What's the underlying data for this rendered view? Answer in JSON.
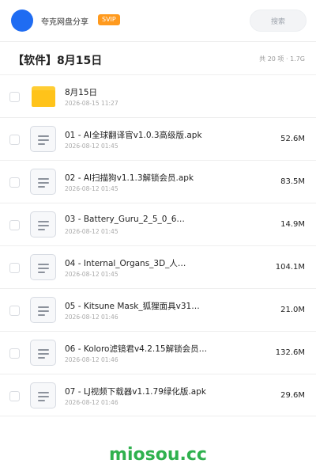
{
  "header": {
    "username": "夸克网盘分享",
    "badge": "SVIP",
    "search_placeholder": "搜索",
    "avatar_color": "#1f6cf2",
    "badge_color": "#ff9a1e"
  },
  "folder": {
    "title": "【软件】8月15日",
    "summary": "共 20 项 · 1.7G"
  },
  "items": [
    {
      "type": "folder",
      "name": "8月15日",
      "date": "2026-08-15 11:27",
      "size": ""
    },
    {
      "type": "file",
      "name": "01 - AI全球翻译官v1.0.3高级版.apk",
      "date": "2026-08-12 01:45",
      "size": "52.6M"
    },
    {
      "type": "file",
      "name": "02 - AI扫描狗v1.1.3解锁会员.apk",
      "date": "2026-08-12 01:45",
      "size": "83.5M"
    },
    {
      "type": "file",
      "name": "03 - Battery_Guru_2_5_0_6…",
      "date": "2026-08-12 01:45",
      "size": "14.9M"
    },
    {
      "type": "file",
      "name": "04 - Internal_Organs_3D_人…",
      "date": "2026-08-12 01:45",
      "size": "104.1M"
    },
    {
      "type": "file",
      "name": "05 - Kitsune Mask_狐狸面具v31…",
      "date": "2026-08-12 01:46",
      "size": "21.0M"
    },
    {
      "type": "file",
      "name": "06 - Koloro滤镜君v4.2.15解锁会员…",
      "date": "2026-08-12 01:46",
      "size": "132.6M"
    },
    {
      "type": "file",
      "name": "07 - LJ视频下载器v1.1.79绿化版.apk",
      "date": "2026-08-12 01:46",
      "size": "29.6M"
    }
  ],
  "watermark": "miosou.cc"
}
